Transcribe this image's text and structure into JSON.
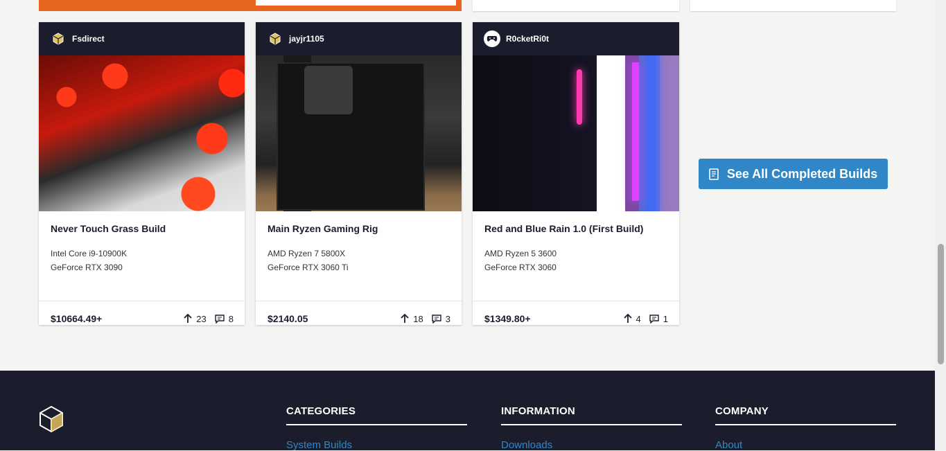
{
  "builds": [
    {
      "user": "Fsdirect",
      "avatar_icon": "cube-icon",
      "title": "Never Touch Grass Build",
      "cpu": "Intel Core i9-10900K",
      "gpu": "GeForce RTX 3090",
      "price": "$10664.49+",
      "upvotes": "23",
      "comments": "8"
    },
    {
      "user": "jayjr1105",
      "avatar_icon": "cube-icon",
      "title": "Main Ryzen Gaming Rig",
      "cpu": "AMD Ryzen 7 5800X",
      "gpu": "GeForce RTX 3060 Ti",
      "price": "$2140.05",
      "upvotes": "18",
      "comments": "3"
    },
    {
      "user": "R0cketRi0t",
      "avatar_icon": "gamepad-icon",
      "title": "Red and Blue Rain 1.0 (First Build)",
      "cpu": "AMD Ryzen 5 3600",
      "gpu": "GeForce RTX 3060",
      "price": "$1349.80+",
      "upvotes": "4",
      "comments": "1"
    }
  ],
  "see_all_label": "See All Completed Builds",
  "footer": {
    "columns": [
      {
        "heading": "CATEGORIES",
        "link": "System Builds"
      },
      {
        "heading": "INFORMATION",
        "link": "Downloads"
      },
      {
        "heading": "COMPANY",
        "link": "About"
      }
    ]
  },
  "colors": {
    "dark": "#1b1d2c",
    "accent_blue": "#2f87c7",
    "accent_orange": "#e8651f"
  }
}
